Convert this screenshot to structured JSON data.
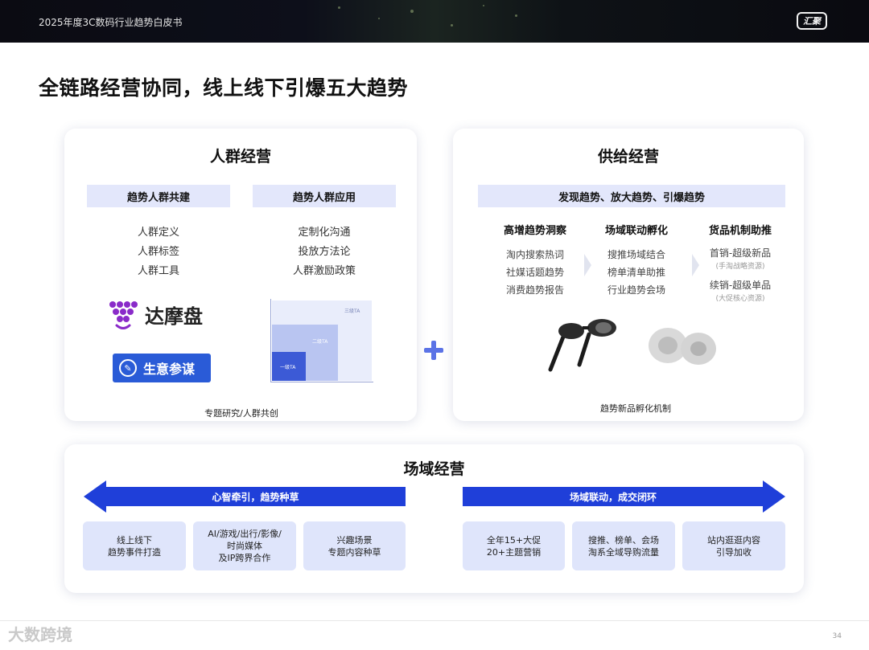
{
  "header": {
    "report_title": "2025年度3C数码行业趋势白皮书",
    "logo_text": "汇聚",
    "logo_icon": "brand-logo-icon"
  },
  "headline": "全链路经营协同，线上线下引爆五大趋势",
  "left_panel": {
    "title": "人群经营",
    "chips": [
      "趋势人群共建",
      "趋势人群应用"
    ],
    "col1_items": [
      "人群定义",
      "人群标签",
      "人群工具"
    ],
    "col2_items": [
      "定制化沟通",
      "投放方法论",
      "人群激励政策"
    ],
    "damopan_label": "达摩盘",
    "shengyi_label": "生意参谋",
    "ta_chart": {
      "levels": [
        "一级TA",
        "二级TA",
        "三级TA"
      ]
    },
    "caption": "专题研究/人群共创"
  },
  "plus_icon": "plus-icon",
  "right_panel": {
    "title": "供给经营",
    "banner": "发现趋势、放大趋势、引爆趋势",
    "columns": [
      {
        "head": "高增趋势洞察",
        "items": [
          "淘内搜索热词",
          "社媒话题趋势",
          "消费趋势报告"
        ]
      },
      {
        "head": "场域联动孵化",
        "items": [
          "搜推场域结合",
          "榜单清单助推",
          "行业趋势会场"
        ]
      },
      {
        "head": "货品机制助推",
        "items": [
          "首销-超级新品",
          "续销-超级单品"
        ],
        "notes": [
          "(手淘战略资源)",
          "(大促核心资源)"
        ]
      }
    ],
    "caption": "趋势新品孵化机制"
  },
  "bottom_panel": {
    "title": "场域经营",
    "left_arrow_label": "心智牵引，趋势种草",
    "right_arrow_label": "场域联动，成交闭环",
    "tiles": [
      "线上线下\n趋势事件打造",
      "AI/游戏/出行/影像/\n时尚媒体\n及IP跨界合作",
      "兴趣场景\n专题内容种草",
      "全年15+大促\n20+主题营销",
      "搜推、榜单、会场\n淘系全域导购流量",
      "站内逛逛内容\n引导加收"
    ]
  },
  "footer": {
    "watermark": "大数跨境",
    "page_number": "34"
  },
  "colors": {
    "accent": "#1f3fd9",
    "chip_bg": "#e3e7fb",
    "tile_bg": "#dfe5fb"
  }
}
